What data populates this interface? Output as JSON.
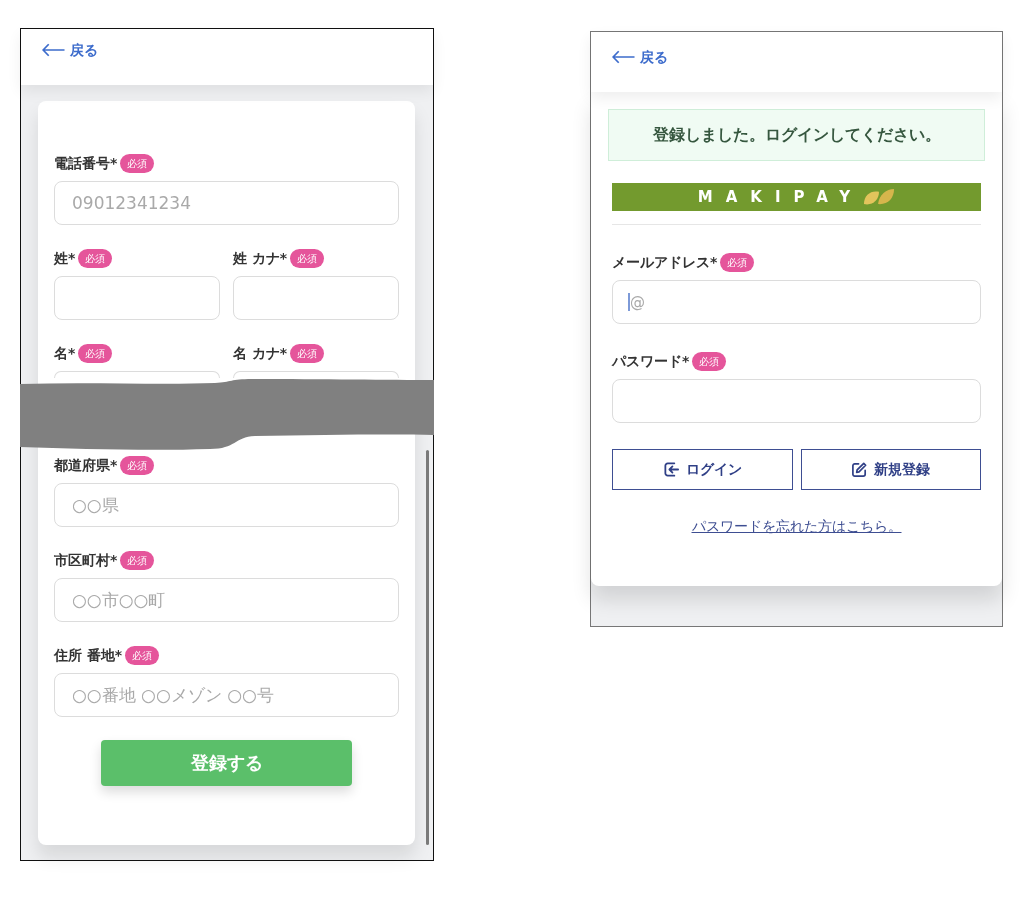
{
  "registration_screen": {
    "back_link": "戻る",
    "sections": [
      {
        "rows": [
          [
            {
              "label": "電話番号*",
              "badge": "必須",
              "placeholder": "09012341234"
            }
          ],
          [
            {
              "label": "姓*",
              "badge": "必須"
            },
            {
              "label": "姓 カナ*",
              "badge": "必須"
            }
          ],
          [
            {
              "label": "名*",
              "badge": "必須"
            },
            {
              "label": "名 カナ*",
              "badge": "必須"
            }
          ]
        ]
      },
      {
        "rows": [
          [
            {
              "label": "都道府県*",
              "badge": "必須",
              "placeholder": "○○県"
            }
          ],
          [
            {
              "label": "市区町村*",
              "badge": "必須",
              "placeholder": "○○市○○町"
            }
          ],
          [
            {
              "label": "住所 番地*",
              "badge": "必須",
              "placeholder": "○○番地 ○○メゾン ○○号"
            }
          ]
        ]
      }
    ],
    "submit_button": "登録する"
  },
  "login_screen": {
    "back_link": "戻る",
    "alert": "登録しました。ログインしてください。",
    "logo": "MAKIPAY",
    "fields": [
      {
        "label": "メールアドレス*",
        "badge": "必須",
        "placeholder": "@",
        "focused": true
      },
      {
        "label": "パスワード*",
        "badge": "必須",
        "focused": false
      }
    ],
    "buttons": [
      {
        "kind": "login",
        "label": "ログイン"
      },
      {
        "kind": "signup",
        "label": "新規登録"
      }
    ],
    "forgot_password_link": "パスワードを忘れた方はこちら。"
  }
}
